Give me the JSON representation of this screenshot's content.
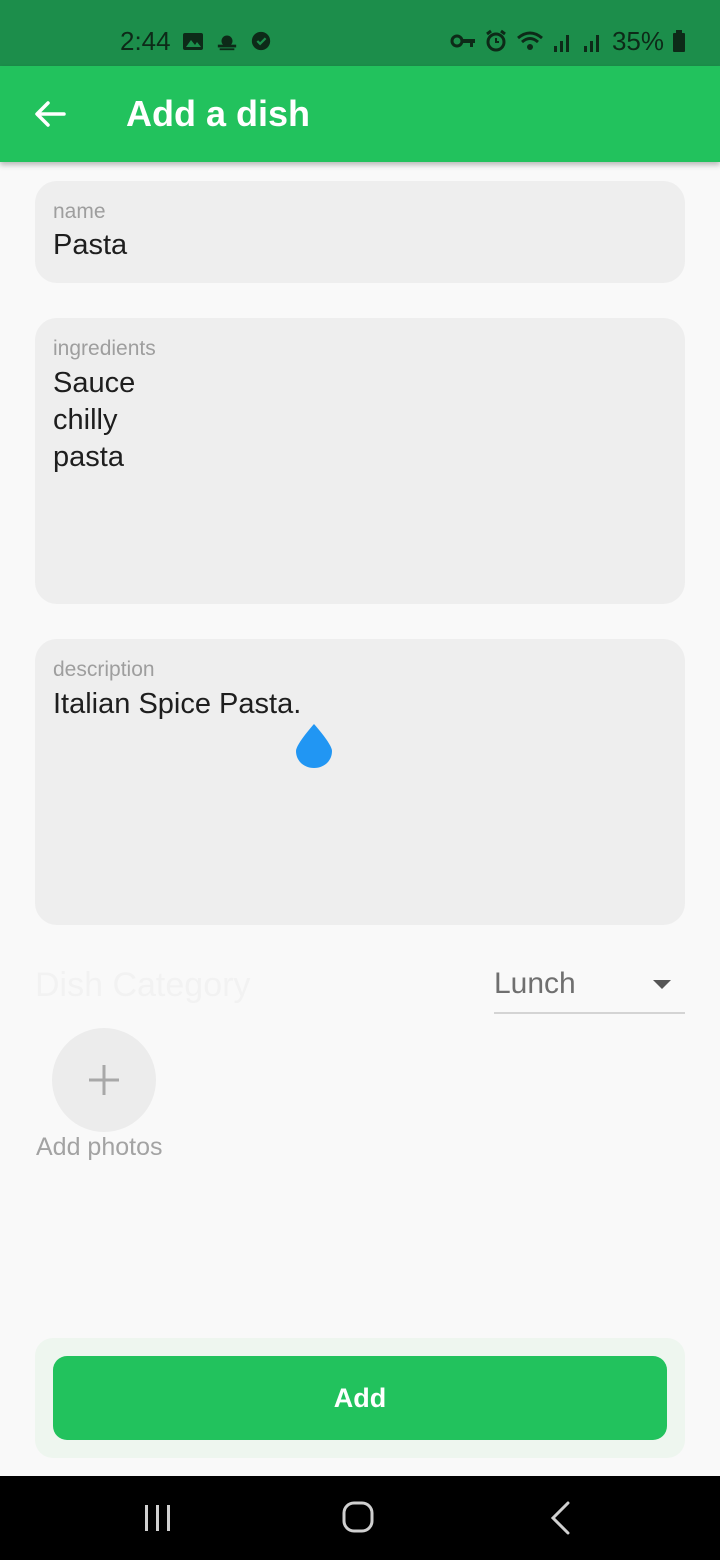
{
  "status_bar": {
    "time": "2:44",
    "battery": "35%",
    "icons_left": [
      "image-icon",
      "weather-icon",
      "app-icon"
    ],
    "icons_right": [
      "vpn-key-icon",
      "alarm-icon",
      "wifi-icon",
      "signal-icon",
      "signal-icon",
      "battery-icon"
    ]
  },
  "app_bar": {
    "title": "Add a dish",
    "back_icon": "arrow-back-icon"
  },
  "form": {
    "name": {
      "label": "name",
      "value": "Pasta"
    },
    "ingredients": {
      "label": "ingredients",
      "value": "Sauce\nchilly\npasta"
    },
    "description": {
      "label": "description",
      "value": "Italian Spice Pasta."
    },
    "category": {
      "label": "Dish Category",
      "value": "Lunch"
    },
    "photos": {
      "label": "Add photos",
      "icon": "plus-icon"
    }
  },
  "actions": {
    "add_label": "Add"
  },
  "colors": {
    "primary": "#22c25d",
    "status_bar": "#1c8e4b",
    "field_bg": "#eeeeee",
    "cursor": "#2196f3"
  },
  "nav_bar": {
    "icons": [
      "recents-icon",
      "home-icon",
      "back-icon"
    ]
  }
}
